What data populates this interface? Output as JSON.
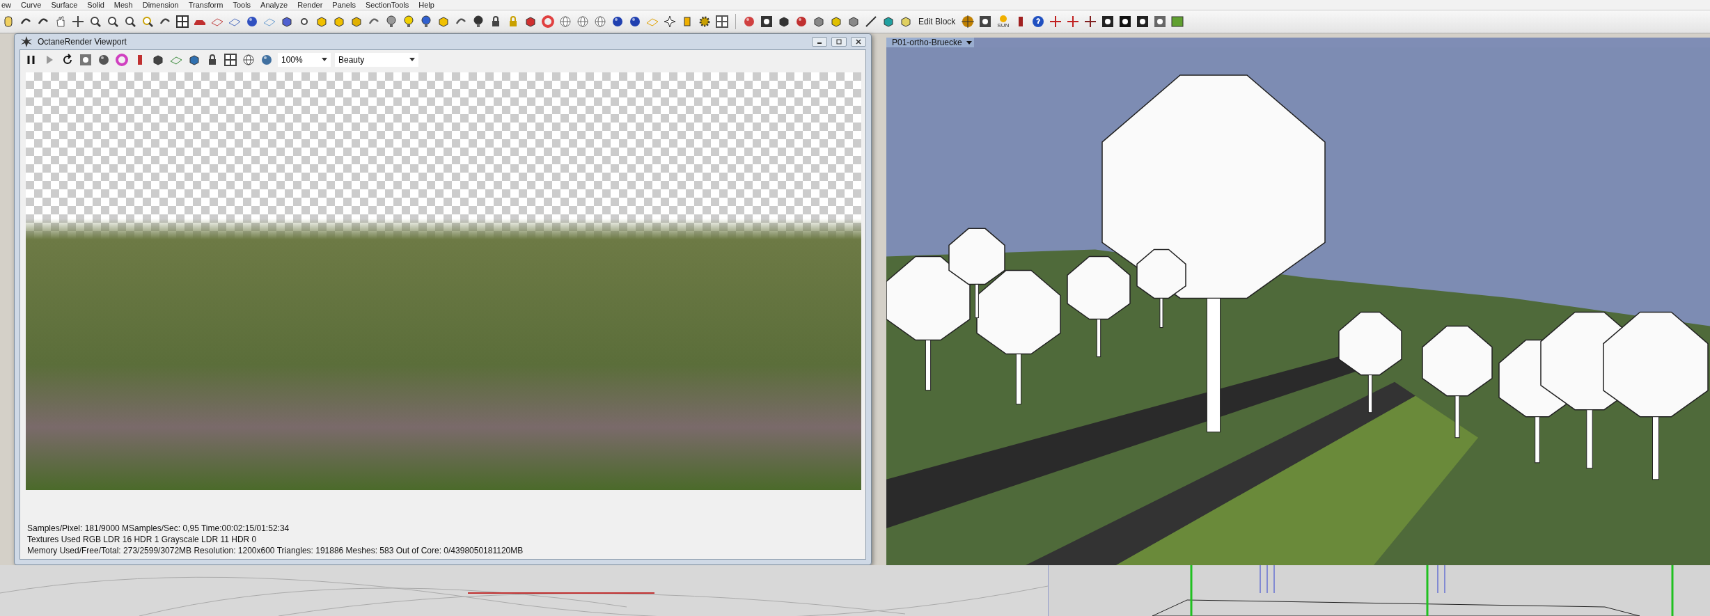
{
  "menu_bar": {
    "items": [
      "ew",
      "Curve",
      "Surface",
      "Solid",
      "Mesh",
      "Dimension",
      "Transform",
      "Tools",
      "Analyze",
      "Render",
      "Panels",
      "SectionTools",
      "Help"
    ]
  },
  "toolbar": {
    "edit_block_label": "Edit Block",
    "sun_label": "SUN"
  },
  "octane_window": {
    "title": "OctaneRender Viewport",
    "zoom": "100%",
    "pass": "Beauty",
    "status_lines": [
      "Samples/Pixel: 181/9000  MSamples/Sec: 0,95  Time:00:02:15/01:52:34",
      "Textures Used RGB LDR 16  HDR 1  Grayscale LDR 11  HDR 0",
      "Memory Used/Free/Total: 273/2599/3072MB  Resolution: 1200x600  Triangles: 191886  Meshes: 583 Out of Core: 0/4398050181120MB"
    ]
  },
  "viewport": {
    "title": "P01-ortho-Bruecke"
  }
}
